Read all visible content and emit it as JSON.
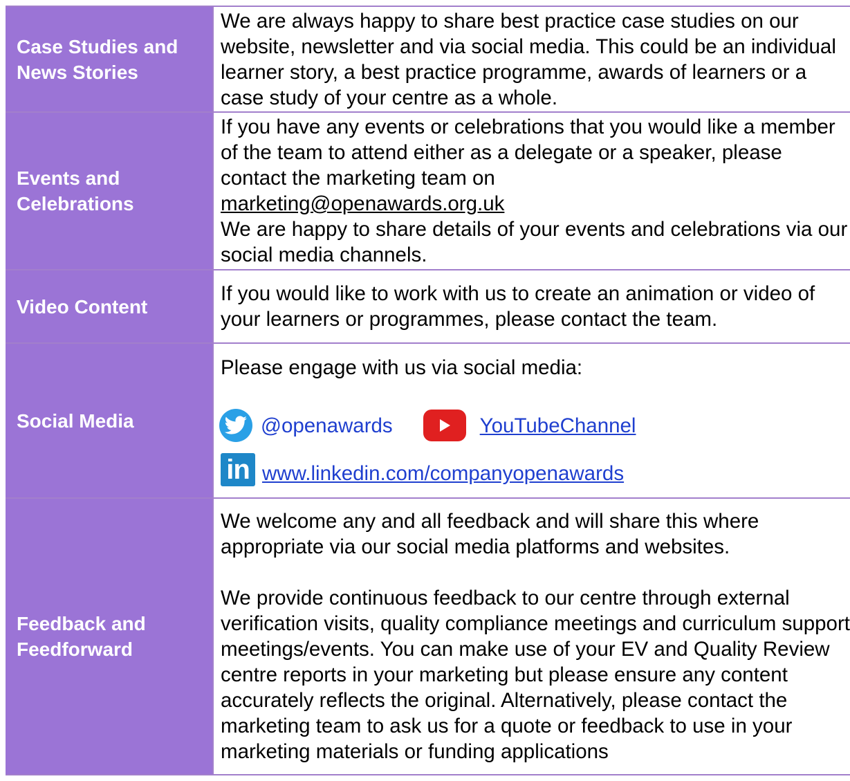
{
  "rows": [
    {
      "label": "Case Studies and News Stories",
      "text": "We are always happy to share best practice case studies on our website, newsletter and via social media. This could be an individual learner story, a best practice programme, awards of learners or a case study of your centre as a whole."
    },
    {
      "label": "Events and Celebrations",
      "text1": "If you have any events or celebrations that you would like a member of the team to attend either as a delegate or a speaker, please contact the marketing team on",
      "email": "marketing@openawards.org.uk",
      "text2": "We are happy to share details of your events and celebrations via our social media channels."
    },
    {
      "label": "Video Content",
      "text": "If you would like to work with us to create an animation or video of your learners or programmes, please contact the team."
    },
    {
      "label": "Social Media",
      "intro": "Please engage with us via social media:",
      "twitter_handle": "@openawards",
      "youtube_label": "YouTubeChannel",
      "linkedin_text": "in",
      "linkedin_url": "www.linkedin.com/companyopenawards"
    },
    {
      "label": "Feedback and Feedforward",
      "para1": "We welcome any and all feedback and will share this where appropriate via our social media platforms and websites.",
      "para2": "We provide continuous feedback to our centre through external verification visits, quality compliance meetings and curriculum support meetings/events. You can make use of your EV and Quality Review centre reports in your marketing but please ensure any content accurately reflects the original. Alternatively, please contact the marketing team to ask us for a quote or feedback to use in your marketing materials or funding applications"
    }
  ],
  "colors": {
    "label_bg": "#9b74d6",
    "border": "#a27fcc",
    "link": "#1f3fcf",
    "twitter": "#2aa0e6",
    "youtube": "#e02020",
    "linkedin": "#1e87c8"
  }
}
